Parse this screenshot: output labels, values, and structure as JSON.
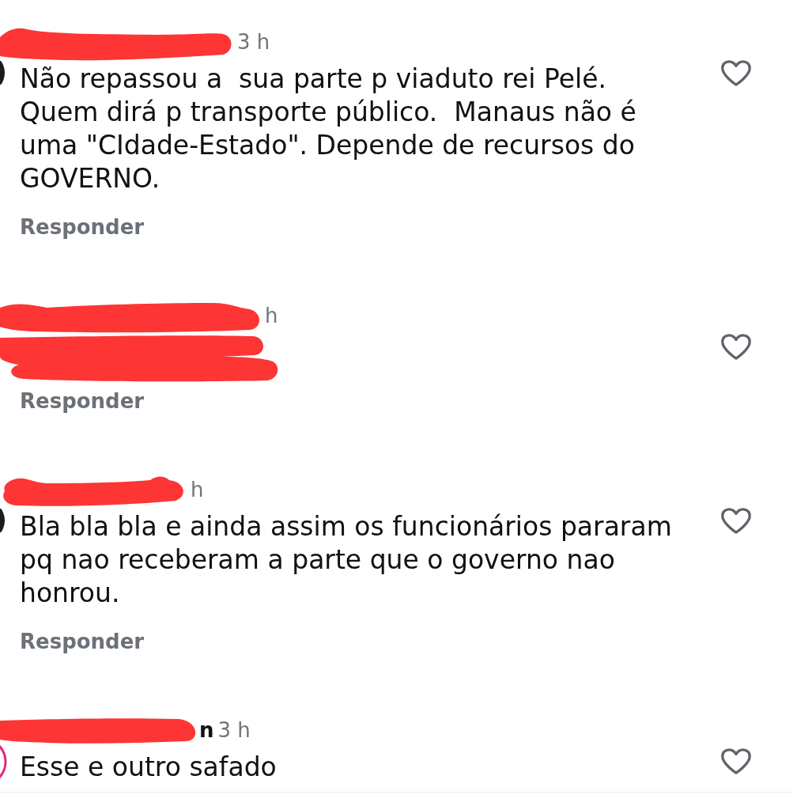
{
  "comments": [
    {
      "avatar_shown": true,
      "story_ring": false,
      "name_redacted": true,
      "time": "3 h",
      "text": "Não repassou a  sua parte p viaduto rei Pelé. Quem dirá p transporte público.  Manaus não é uma \"CIdade-Estado\". Depende de recursos do GOVERNO.",
      "reply": "Responder",
      "liked": false
    },
    {
      "name_redacted": true,
      "time": "h",
      "body_redacted": true,
      "reply": "Responder",
      "liked": false
    },
    {
      "avatar_shown": true,
      "story_ring": false,
      "name_redacted": true,
      "time": "h",
      "text": "Bla bla bla e ainda assim os funcionários pararam pq nao receberam a parte que o governo nao honrou.",
      "reply": "Responder",
      "liked": false
    },
    {
      "avatar_shown": true,
      "story_ring": true,
      "name_redacted": true,
      "name_fragment": "n",
      "time": "3 h",
      "text": "Esse e outro safado",
      "liked": false
    }
  ]
}
